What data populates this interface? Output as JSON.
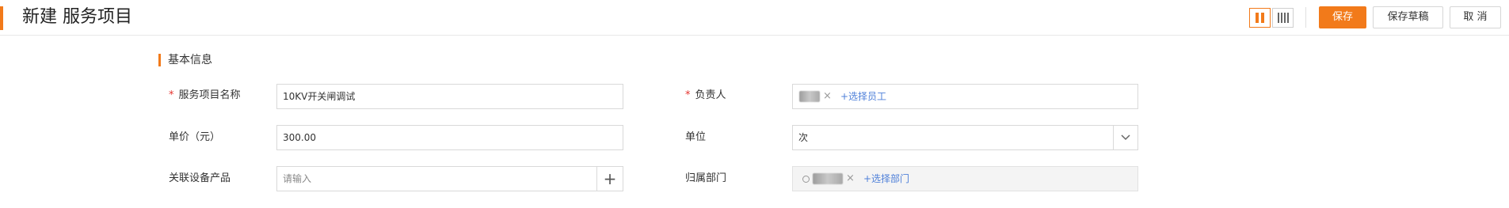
{
  "header": {
    "title": "新建 服务项目",
    "buttons": {
      "save": "保存",
      "save_draft": "保存草稿",
      "cancel": "取 消"
    }
  },
  "colors": {
    "accent": "#f27a1a",
    "required": "#e5322d",
    "link": "#4f80d9"
  },
  "layout_toggle": {
    "options": [
      "two-column",
      "four-column"
    ],
    "selected": "two-column"
  },
  "section": {
    "title": "基本信息"
  },
  "form": {
    "service_name": {
      "label": "服务项目名称",
      "required_mark": "*",
      "value": "10KV开关闸调试"
    },
    "owner": {
      "label": "负责人",
      "required_mark": "*",
      "tag_close": "×",
      "add_label": "+选择员工"
    },
    "unit_price": {
      "label": "单价（元）",
      "value": "300.00"
    },
    "unit": {
      "label": "单位",
      "value": "次"
    },
    "related_product": {
      "label": "关联设备产品",
      "placeholder": "请输入",
      "add_icon": "+"
    },
    "department": {
      "label": "归属部门",
      "tag_close": "×",
      "add_label": "+选择部门"
    }
  }
}
